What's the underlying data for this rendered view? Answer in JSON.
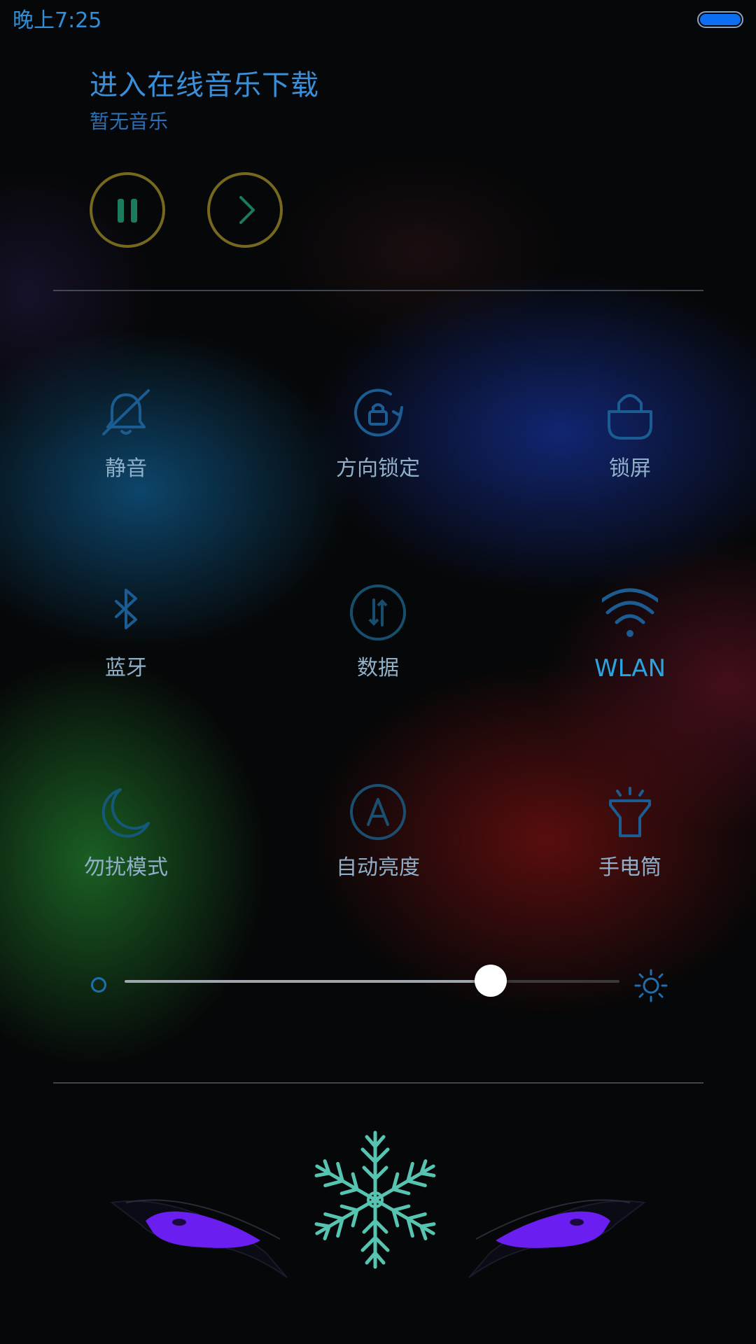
{
  "status_bar": {
    "time": "晚上7:25",
    "battery_level": 1.0,
    "battery_color": "#0d6ef2"
  },
  "music": {
    "title": "进入在线音乐下载",
    "subtitle": "暂无音乐",
    "controls": [
      {
        "name": "pause",
        "icon": "pause-icon"
      },
      {
        "name": "next",
        "icon": "chevron-right-icon"
      }
    ]
  },
  "toggles": [
    {
      "label": "静音",
      "icon": "bell-off-icon",
      "active": false
    },
    {
      "label": "方向锁定",
      "icon": "rotation-lock-icon",
      "active": false
    },
    {
      "label": "锁屏",
      "icon": "lock-icon",
      "active": false
    },
    {
      "label": "蓝牙",
      "icon": "bluetooth-icon",
      "active": false
    },
    {
      "label": "数据",
      "icon": "mobile-data-icon",
      "active": false
    },
    {
      "label": "WLAN",
      "icon": "wifi-icon",
      "active": true
    },
    {
      "label": "勿扰模式",
      "icon": "moon-icon",
      "active": false
    },
    {
      "label": "自动亮度",
      "icon": "auto-brightness-icon",
      "active": false
    },
    {
      "label": "手电筒",
      "icon": "flashlight-icon",
      "active": false
    }
  ],
  "brightness": {
    "level": 0.74,
    "min_icon": "brightness-low-icon",
    "max_icon": "sun-icon"
  },
  "colors": {
    "accent": "#2aa4e0",
    "icon": "#1b5d92",
    "label": "#8fb0c8",
    "media_ring": "#76691f"
  },
  "decoration": {
    "icons": [
      "snowflake-icon",
      "left-eye-icon",
      "right-eye-icon"
    ],
    "eye_color": "#6a1ff0",
    "snowflake_color": "#56c4b0"
  }
}
